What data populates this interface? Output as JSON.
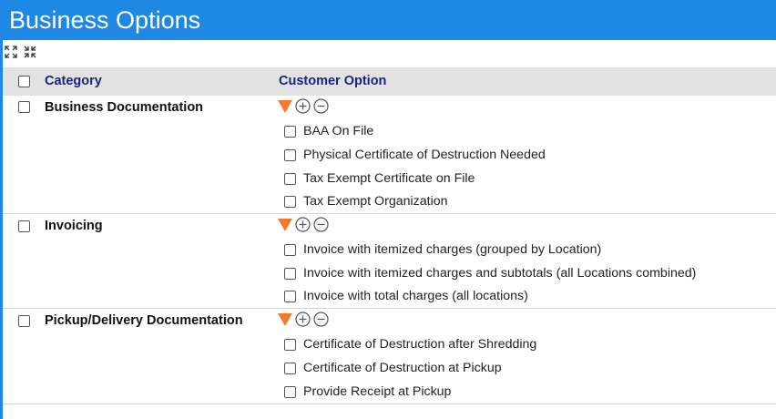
{
  "header": {
    "title": "Business Options"
  },
  "toolbar": {
    "expand_icon": "expand-all-icon",
    "collapse_icon": "collapse-all-icon"
  },
  "table": {
    "columns": {
      "category": "Category",
      "customer_option": "Customer Option"
    },
    "groups": [
      {
        "name": "Business Documentation",
        "options": [
          "BAA On File",
          "Physical Certificate of Destruction Needed",
          "Tax Exempt Certificate on File",
          "Tax Exempt Organization"
        ]
      },
      {
        "name": "Invoicing",
        "options": [
          "Invoice with itemized charges (grouped by Location)",
          "Invoice with itemized charges and subtotals (all Locations combined)",
          "Invoice with total charges (all locations)"
        ]
      },
      {
        "name": "Pickup/Delivery Documentation",
        "options": [
          "Certificate of Destruction after Shredding",
          "Certificate of Destruction at Pickup",
          "Provide Receipt at Pickup"
        ]
      }
    ]
  },
  "colors": {
    "title_bar": "#1e88e5",
    "header_text": "#1a237e",
    "triangle": "#f07a2e"
  }
}
